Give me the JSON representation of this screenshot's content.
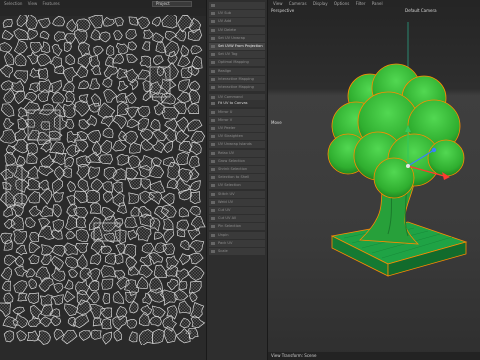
{
  "uv_editor": {
    "menu": [
      "Selection",
      "View",
      "Features"
    ],
    "mode_select": "Project",
    "coord_readout": "1.0"
  },
  "command_panel": {
    "items": [
      {
        "label": "",
        "state": "normal"
      },
      {
        "label": "UV Sub",
        "state": "normal"
      },
      {
        "label": "UV Add",
        "state": "normal"
      },
      {
        "label": "UV Delete",
        "state": "normal"
      },
      {
        "label": "Set UV Unwrap",
        "state": "normal"
      },
      {
        "label": "Set UVW From Projection",
        "state": "active"
      },
      {
        "label": "Set UV Tag",
        "state": "normal"
      },
      {
        "label": "Optimal Mapping",
        "state": "normal"
      },
      {
        "label": "Realign",
        "state": "normal"
      },
      {
        "label": "Interactive Mapping",
        "state": "normal"
      },
      {
        "label": "Interactive Mapping",
        "state": "normal"
      },
      {
        "label": "UV Command",
        "state": "normal"
      },
      {
        "label": "Fit UV to Canvas",
        "state": "header"
      },
      {
        "label": "Mirror U",
        "state": "normal"
      },
      {
        "label": "Mirror V",
        "state": "normal"
      },
      {
        "label": "UV Peeler",
        "state": "normal"
      },
      {
        "label": "UV Straighten",
        "state": "normal"
      },
      {
        "label": "UV Unwrap Islands",
        "state": "normal"
      },
      {
        "label": "Relax UV",
        "state": "normal"
      },
      {
        "label": "Grow Selection",
        "state": "normal"
      },
      {
        "label": "Shrink Selection",
        "state": "normal"
      },
      {
        "label": "Selection to Shell",
        "state": "normal"
      },
      {
        "label": "UV Selection",
        "state": "normal"
      },
      {
        "label": "Stitch UV",
        "state": "normal"
      },
      {
        "label": "Weld UV",
        "state": "normal"
      },
      {
        "label": "Cut UV",
        "state": "normal"
      },
      {
        "label": "Cut UV All",
        "state": "normal"
      },
      {
        "label": "Pin Selection",
        "state": "normal"
      },
      {
        "label": "Unpin",
        "state": "normal"
      },
      {
        "label": "Pack UV",
        "state": "normal"
      },
      {
        "label": "Scale",
        "state": "normal"
      }
    ]
  },
  "viewport": {
    "menu": [
      "View",
      "Cameras",
      "Display",
      "Options",
      "Filter",
      "Panel"
    ],
    "view_label": "Perspective",
    "camera_label": "Default Camera",
    "tool_label": "Move",
    "status": "View Transform: Scene"
  },
  "colors": {
    "uv_line": "#d9d9d9",
    "tree_green_light": "#3fc43f",
    "tree_green_dark": "#1f7a1f",
    "base_green": "#1e9c3c",
    "selection_outline": "#ff8a00",
    "axis_y": "#34c759",
    "axis_x": "#ff3b30",
    "axis_z": "#3b7dff"
  }
}
